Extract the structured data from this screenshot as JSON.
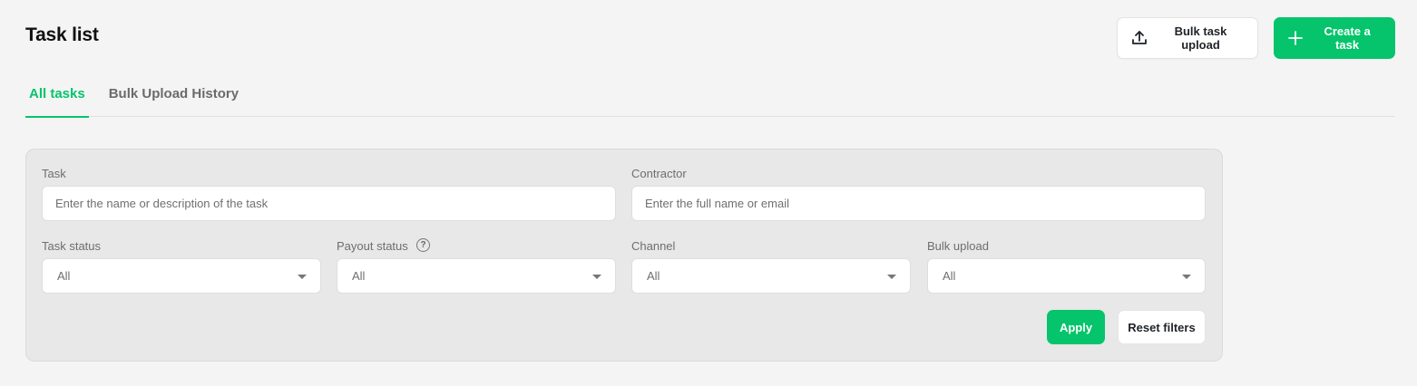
{
  "header": {
    "title": "Task list",
    "bulk_upload_label": "Bulk task upload",
    "create_label": "Create a task"
  },
  "tabs": [
    {
      "label": "All tasks",
      "active": true
    },
    {
      "label": "Bulk Upload History",
      "active": false
    }
  ],
  "filters": {
    "task": {
      "label": "Task",
      "placeholder": "Enter the name or description of the task",
      "value": ""
    },
    "contractor": {
      "label": "Contractor",
      "placeholder": "Enter the full name or email",
      "value": ""
    },
    "task_status": {
      "label": "Task status",
      "value": "All"
    },
    "payout_status": {
      "label": "Payout status",
      "value": "All",
      "help_glyph": "?"
    },
    "channel": {
      "label": "Channel",
      "value": "All"
    },
    "bulk_upload": {
      "label": "Bulk upload",
      "value": "All"
    },
    "apply_label": "Apply",
    "reset_label": "Reset filters"
  },
  "colors": {
    "accent": "#05c46b",
    "background": "#f4f4f4",
    "filter_panel": "#e7e8e7"
  },
  "icons": {
    "bulk_upload": "upload-icon",
    "create": "plus-icon",
    "help": "help-circle-icon",
    "dropdown": "caret-down-icon"
  }
}
